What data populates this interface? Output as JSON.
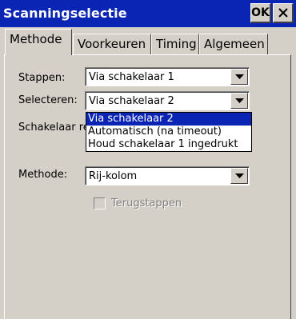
{
  "window": {
    "title": "Scanningselectie",
    "ok_label": "OK"
  },
  "tabs": [
    {
      "label": "Methode",
      "active": true
    },
    {
      "label": "Voorkeuren",
      "active": false
    },
    {
      "label": "Timing",
      "active": false
    },
    {
      "label": "Algemeen",
      "active": false
    }
  ],
  "form": {
    "stappen": {
      "label": "Stappen:",
      "value": "Via schakelaar 1"
    },
    "selecteren": {
      "label": "Selecteren:",
      "value": "Via schakelaar 2",
      "options": [
        "Via schakelaar 2",
        "Automatisch (na timeout)",
        "Houd schakelaar 1 ingedrukt"
      ],
      "selected_option": "Via schakelaar 2"
    },
    "schakelaar_re": {
      "label_visible": "Schakelaar re"
    },
    "methode": {
      "label": "Methode:",
      "value": "Rij-kolom"
    },
    "terugstappen": {
      "label": "Terugstappen",
      "checked": false,
      "enabled": false
    }
  },
  "colors": {
    "titlebar": "#0a24b4",
    "face": "#d4d0c8",
    "selection": "#0a24b4",
    "disabled_text": "#808080"
  },
  "icons": {
    "close": "close-icon",
    "dropdown": "chevron-down-icon"
  }
}
